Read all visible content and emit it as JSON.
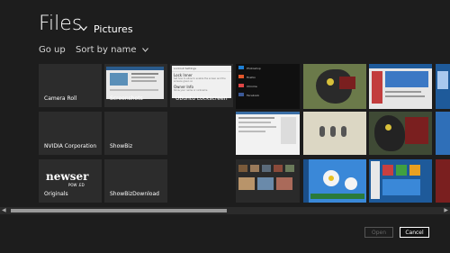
{
  "header": {
    "title": "Files",
    "location": "Pictures"
  },
  "commands": {
    "go_up": "Go up",
    "sort": "Sort by name"
  },
  "folders": [
    {
      "label": "Camera Roll"
    },
    {
      "label": "Screenshots"
    },
    {
      "label": "Ubuntu Lockscreen"
    },
    {
      "label": "NVIDIA Corporation"
    },
    {
      "label": "ShowBiz"
    },
    {
      "label": "Originals",
      "logo_text": "newser",
      "logo_sub": "POW .ED"
    },
    {
      "label": "ShowBizDownload"
    }
  ],
  "lockscreen_menu": {
    "heading": "Lockout Settings",
    "items": [
      {
        "title": "Lock Inner",
        "sub": "Set how to allow to enable the screen and the screens given on"
      },
      {
        "title": "Owner Info",
        "sub": "Show your name or nickname"
      }
    ]
  },
  "apps_list": [
    "Photoshop",
    "Firefox",
    "Chrome",
    "Facebook"
  ],
  "footer": {
    "open_label": "Open",
    "cancel_label": "Cancel"
  },
  "colors": {
    "background": "#1d1d1d",
    "tile": "#2c2c2c",
    "accent_blue": "#1e7fd4"
  }
}
